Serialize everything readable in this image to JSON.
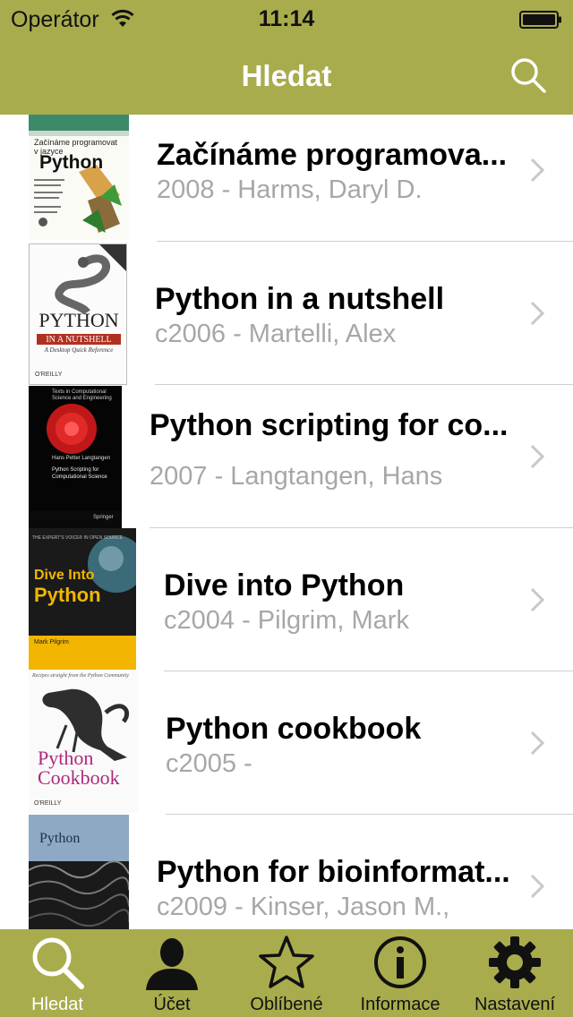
{
  "status_bar": {
    "carrier": "Operátor",
    "time": "11:14"
  },
  "nav": {
    "title": "Hledat"
  },
  "books": [
    {
      "title": "Začínáme programova...",
      "subtitle": "2008 - Harms, Daryl D."
    },
    {
      "title": "Python in a nutshell",
      "subtitle": "c2006 - Martelli, Alex"
    },
    {
      "title": "Python scripting for co...",
      "subtitle": "2007 - Langtangen, Hans"
    },
    {
      "title": "Dive into Python",
      "subtitle": "c2004 - Pilgrim, Mark"
    },
    {
      "title": "Python cookbook",
      "subtitle": "c2005 -"
    },
    {
      "title": "Python for bioinformat...",
      "subtitle": "c2009 - Kinser, Jason M.,"
    }
  ],
  "covers": {
    "c1": {
      "top": "Začínáme programovat v jazyce",
      "main": "Python"
    },
    "c2": {
      "main": "PYTHON",
      "band": "IN A NUTSHELL",
      "sub": "A Desktop Quick Reference",
      "pub": "O'REILLY"
    },
    "c3": {
      "series": "Texts in Computational Science and Engineering",
      "author": "Hans Petter Langtangen",
      "title": "Python Scripting for Computational Science",
      "pub": "Springer"
    },
    "c4": {
      "top": "THE EXPERT'S VOICE® IN OPEN SOURCE",
      "main1": "Dive Into",
      "main2": "Python",
      "author": "Mark Pilgrim"
    },
    "c5": {
      "top": "Recipes straight from the Python Community",
      "main1": "Python",
      "main2": "Cookbook",
      "pub": "O'REILLY"
    },
    "c6": {
      "main": "Python"
    }
  },
  "tabs": [
    {
      "label": "Hledat",
      "icon": "search-icon",
      "active": true
    },
    {
      "label": "Účet",
      "icon": "account-icon",
      "active": false
    },
    {
      "label": "Oblíbené",
      "icon": "star-icon",
      "active": false
    },
    {
      "label": "Informace",
      "icon": "info-icon",
      "active": false
    },
    {
      "label": "Nastavení",
      "icon": "gear-icon",
      "active": false
    }
  ],
  "colors": {
    "bar": "#a8ac4c",
    "subtitle": "#a7a7a7",
    "separator": "#cfcfcf"
  }
}
